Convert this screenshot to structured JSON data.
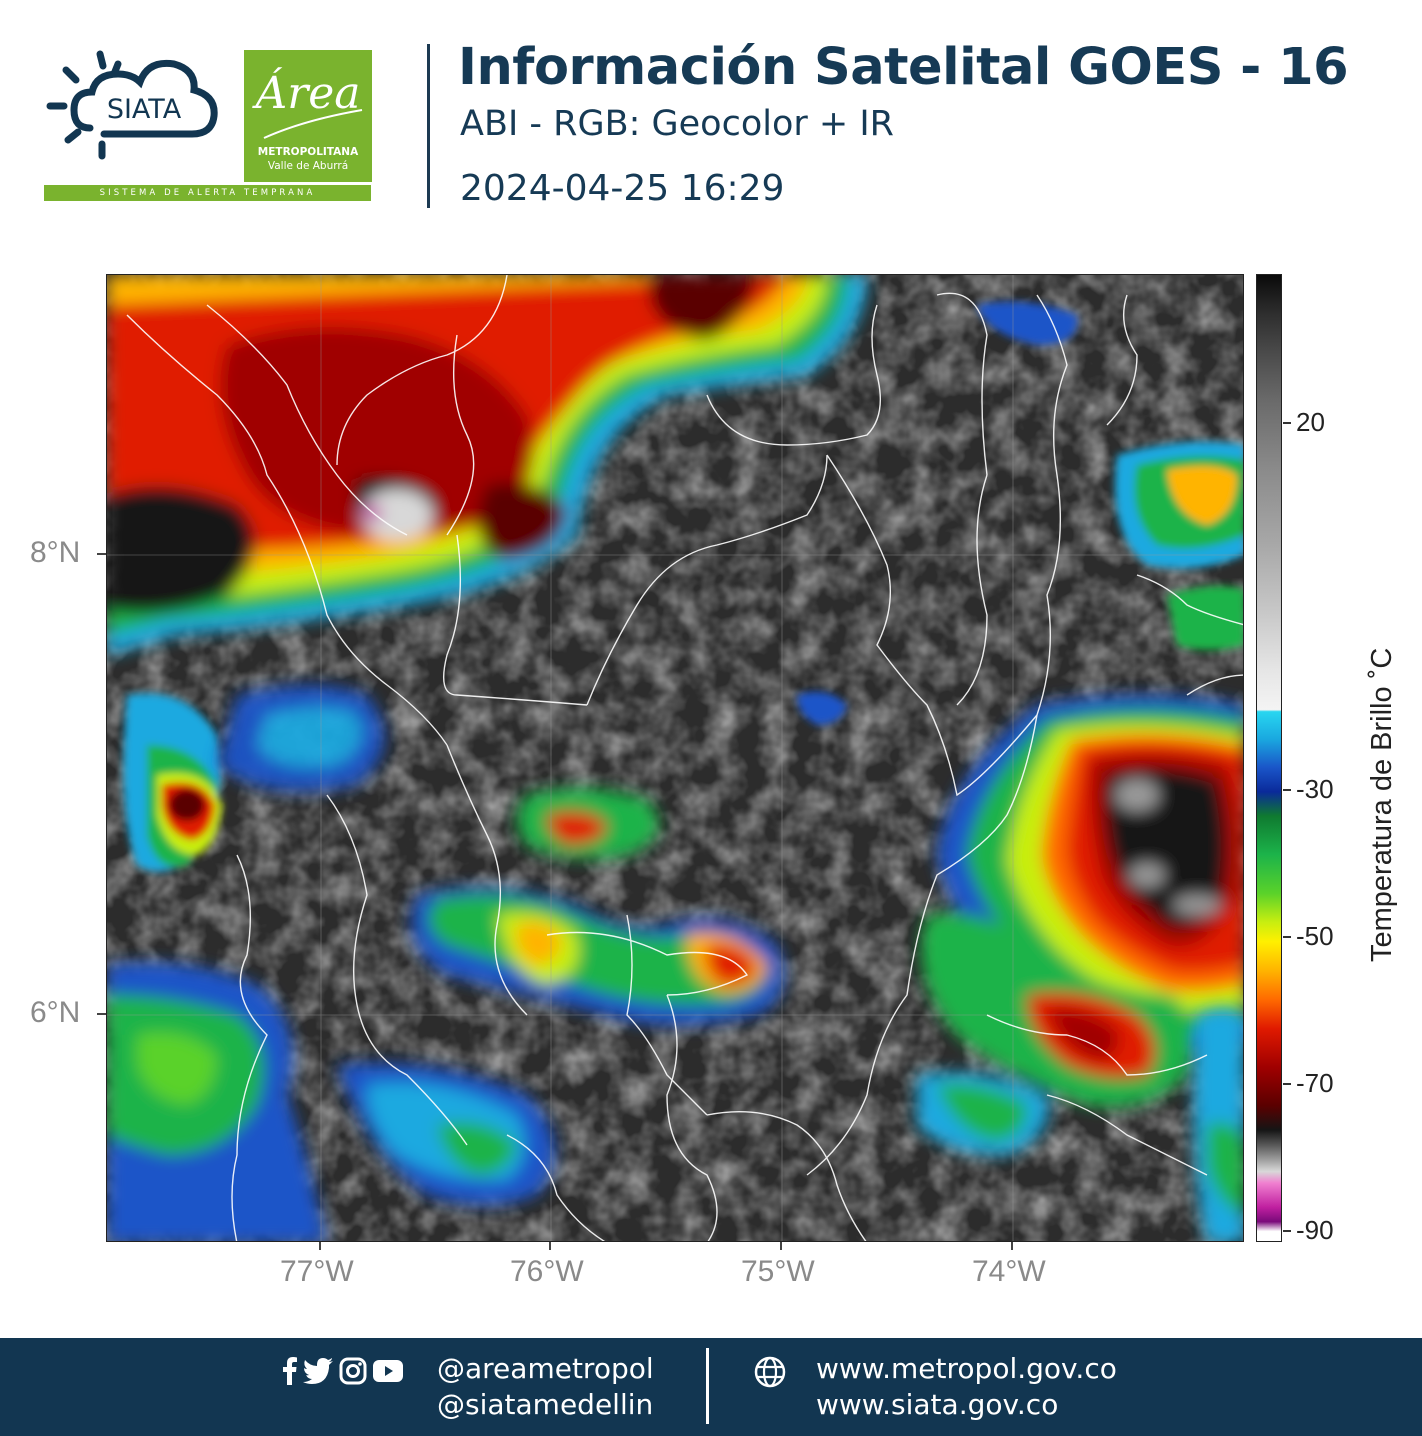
{
  "header": {
    "siata_logo_text": "SIATA",
    "area_logo_word": "Área",
    "area_logo_sub1": "METROPOLITANA",
    "area_logo_sub2": "Valle de Aburrá",
    "logo_tagline": "SISTEMA DE ALERTA TEMPRANA",
    "title": "Información Satelital GOES - 16",
    "subtitle": "ABI - RGB: Geocolor + IR",
    "datetime": "2024-04-25 16:29"
  },
  "map": {
    "lat_labels": [
      "8°N",
      "6°N"
    ],
    "lon_labels": [
      "77°W",
      "76°W",
      "75°W",
      "74°W"
    ],
    "gridlines": true
  },
  "colorbar": {
    "title": "Temperatura de Brillo ˚C",
    "ticks": [
      "20",
      "-30",
      "-50",
      "-70",
      "-90"
    ],
    "range": [
      -90,
      30
    ],
    "colors": {
      "cold_cloud_tops": "#a00000",
      "cloud_mid": "#1cb34a",
      "cloud_low": "#1a55c8",
      "overshooting": "#c020a0"
    }
  },
  "footer": {
    "social_icons": [
      "facebook-icon",
      "twitter-icon",
      "instagram-icon",
      "youtube-icon"
    ],
    "handle_1": "@areametropol",
    "handle_2": "@siatamedellin",
    "web_1": "www.metropol.gov.co",
    "web_2": "www.siata.gov.co",
    "background_color": "#123651"
  }
}
